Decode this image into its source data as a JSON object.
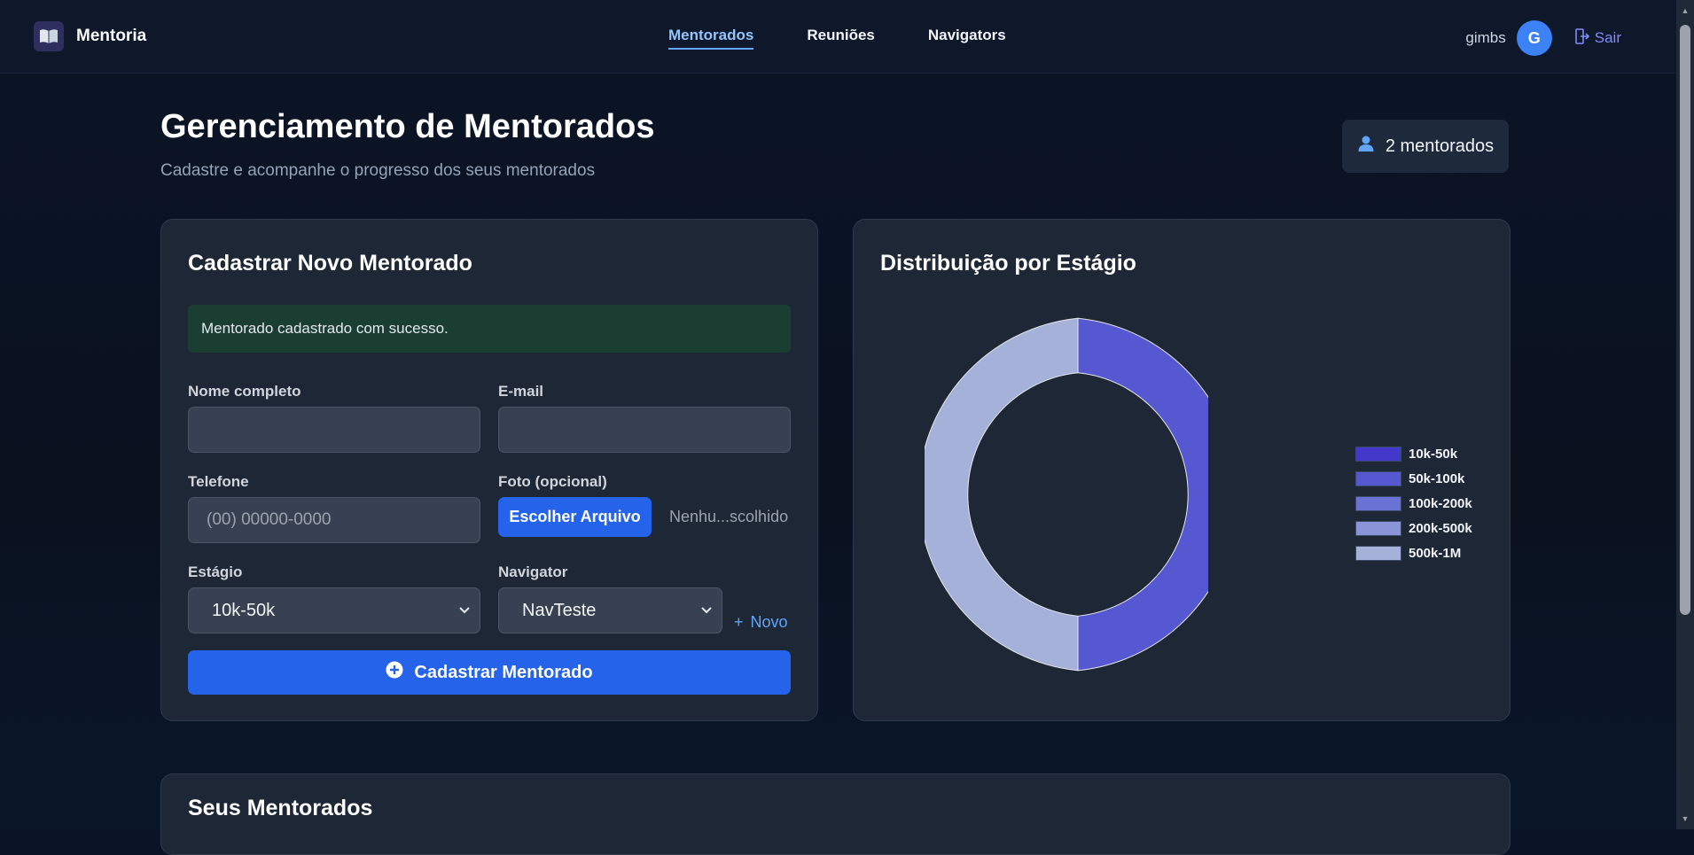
{
  "brand": {
    "name": "Mentoria",
    "logo_icon": "book-icon"
  },
  "nav": {
    "links": [
      {
        "label": "Mentorados",
        "active": true
      },
      {
        "label": "Reuniões",
        "active": false
      },
      {
        "label": "Navigators",
        "active": false
      }
    ]
  },
  "user": {
    "name": "gimbs",
    "initial": "G",
    "logout_label": "Sair"
  },
  "page": {
    "title": "Gerenciamento de Mentorados",
    "subtitle": "Cadastre e acompanhe o progresso dos seus mentorados",
    "count_label": "2 mentorados"
  },
  "form": {
    "title": "Cadastrar Novo Mentorado",
    "success_message": "Mentorado cadastrado com sucesso.",
    "name_label": "Nome completo",
    "name_value": "",
    "email_label": "E-mail",
    "email_value": "",
    "phone_label": "Telefone",
    "phone_placeholder": "(00) 00000-0000",
    "photo_label": "Foto (opcional)",
    "file_button": "Escolher Arquivo",
    "file_name": "Nenhu...scolhido",
    "stage_label": "Estágio",
    "stage_value": "10k-50k",
    "navigator_label": "Navigator",
    "navigator_value": "NavTeste",
    "new_navigator": "Novo",
    "submit_label": "Cadastrar Mentorado"
  },
  "chart": {
    "title": "Distribuição por Estágio"
  },
  "chart_data": {
    "type": "pie",
    "categories": [
      "10k-50k",
      "50k-100k",
      "100k-200k",
      "200k-500k",
      "500k-1M"
    ],
    "values": [
      0,
      1,
      0,
      0,
      1
    ],
    "colors": [
      "#4338ca",
      "#5558d0",
      "#6b72d6",
      "#8a94d9",
      "#a5b1d9"
    ],
    "legend": "right"
  },
  "list": {
    "title": "Seus Mentorados"
  }
}
